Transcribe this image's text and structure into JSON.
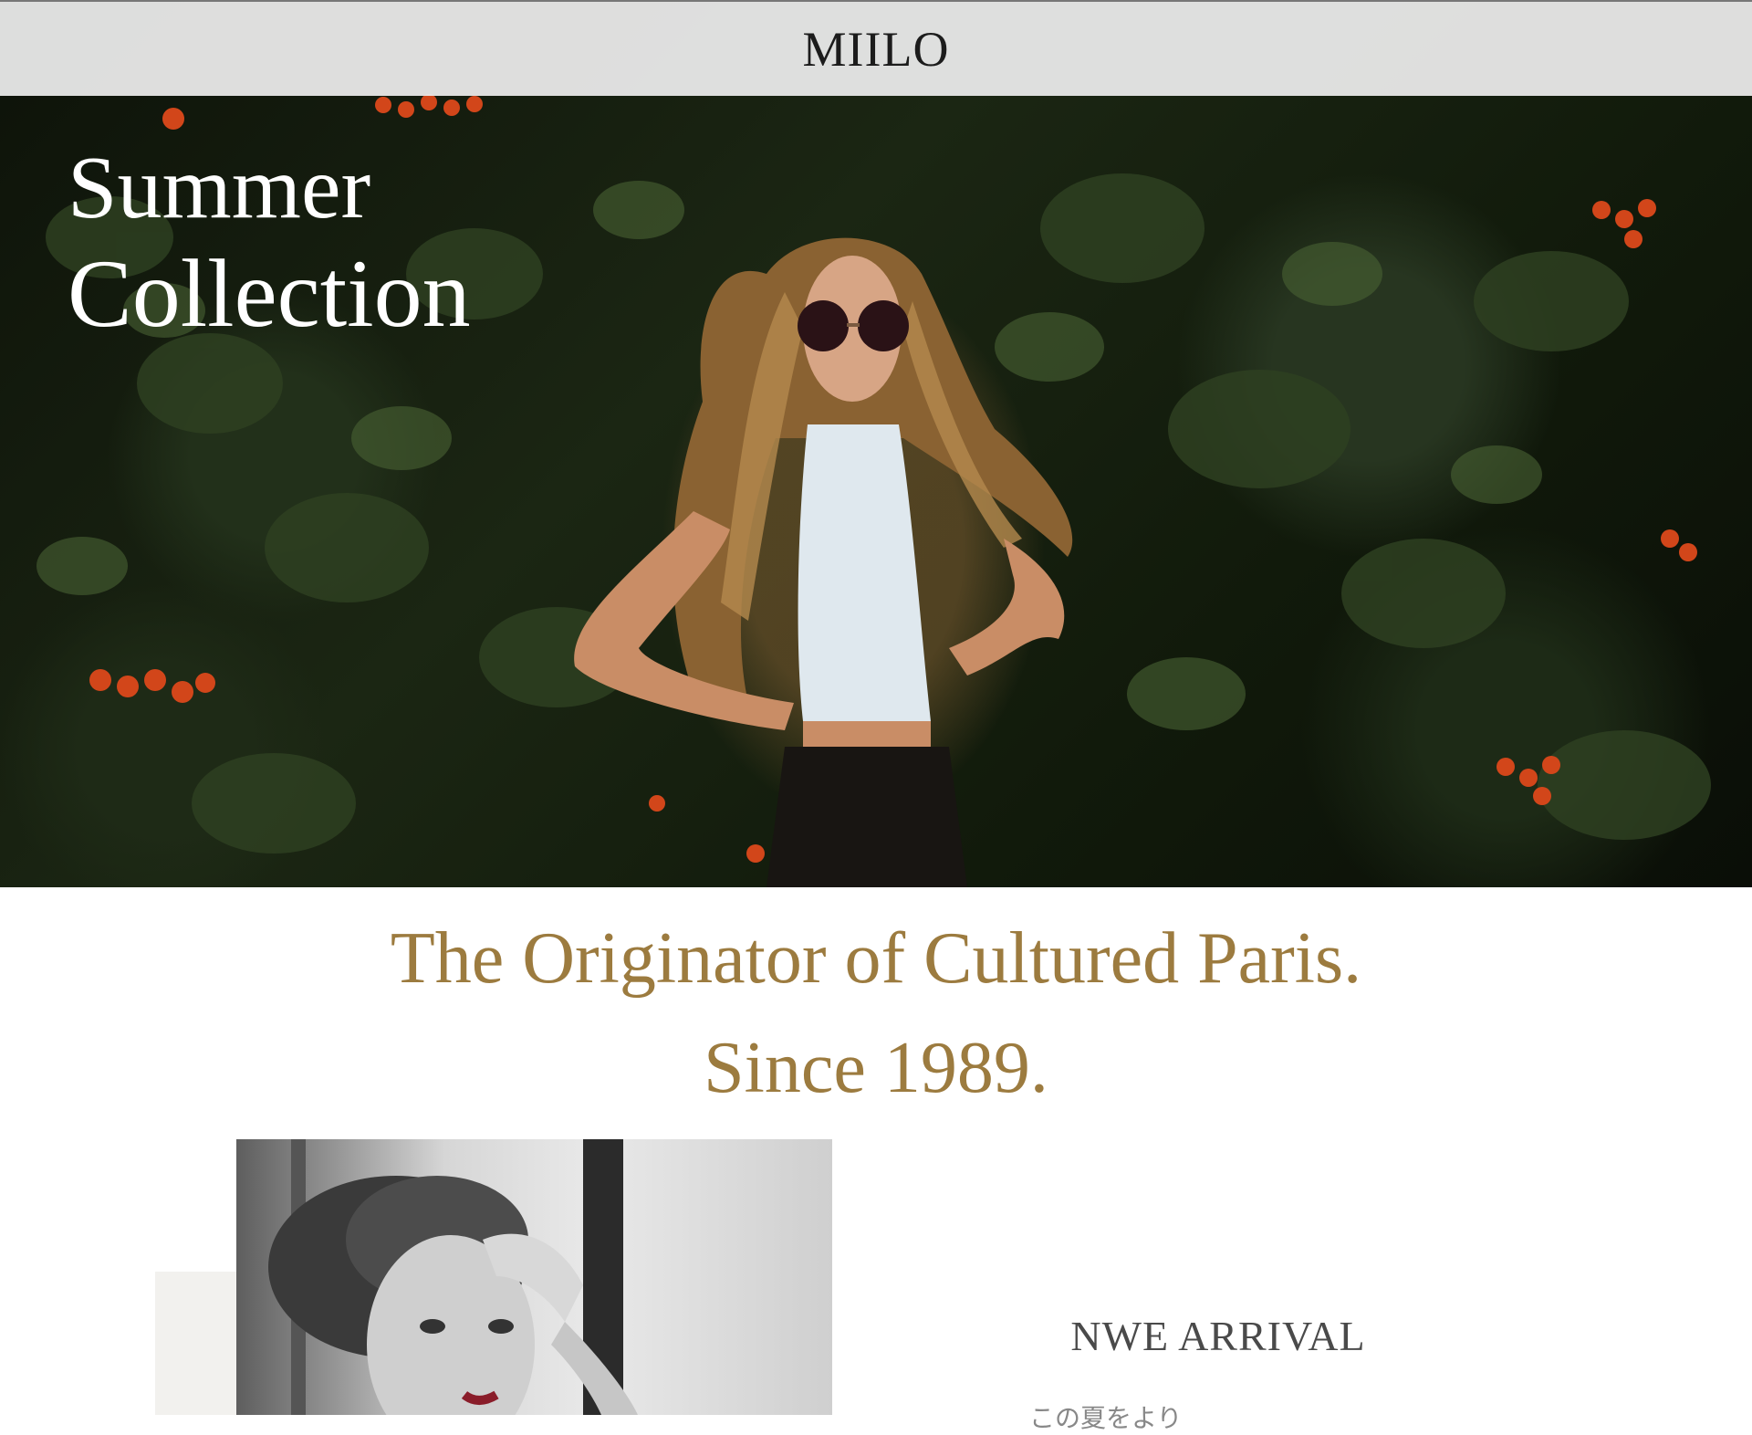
{
  "header": {
    "logo": "MIILO"
  },
  "hero": {
    "title_line1": "Summer",
    "title_line2": "Collection",
    "image_alt": "Woman with long curly hair and sunglasses in front of ivy wall with orange flowers"
  },
  "tagline": {
    "line1": "The Originator of Cultured Paris.",
    "line2": "Since 1989."
  },
  "feature": {
    "image_alt": "Black and white portrait of a woman",
    "heading": "NWE ARRIVAL",
    "text": "この夏をより"
  },
  "colors": {
    "accent_gold": "#9c7b3f",
    "header_bg": "#ebebeb",
    "logo_text": "#1c1c1c",
    "hero_text": "#ffffff"
  }
}
